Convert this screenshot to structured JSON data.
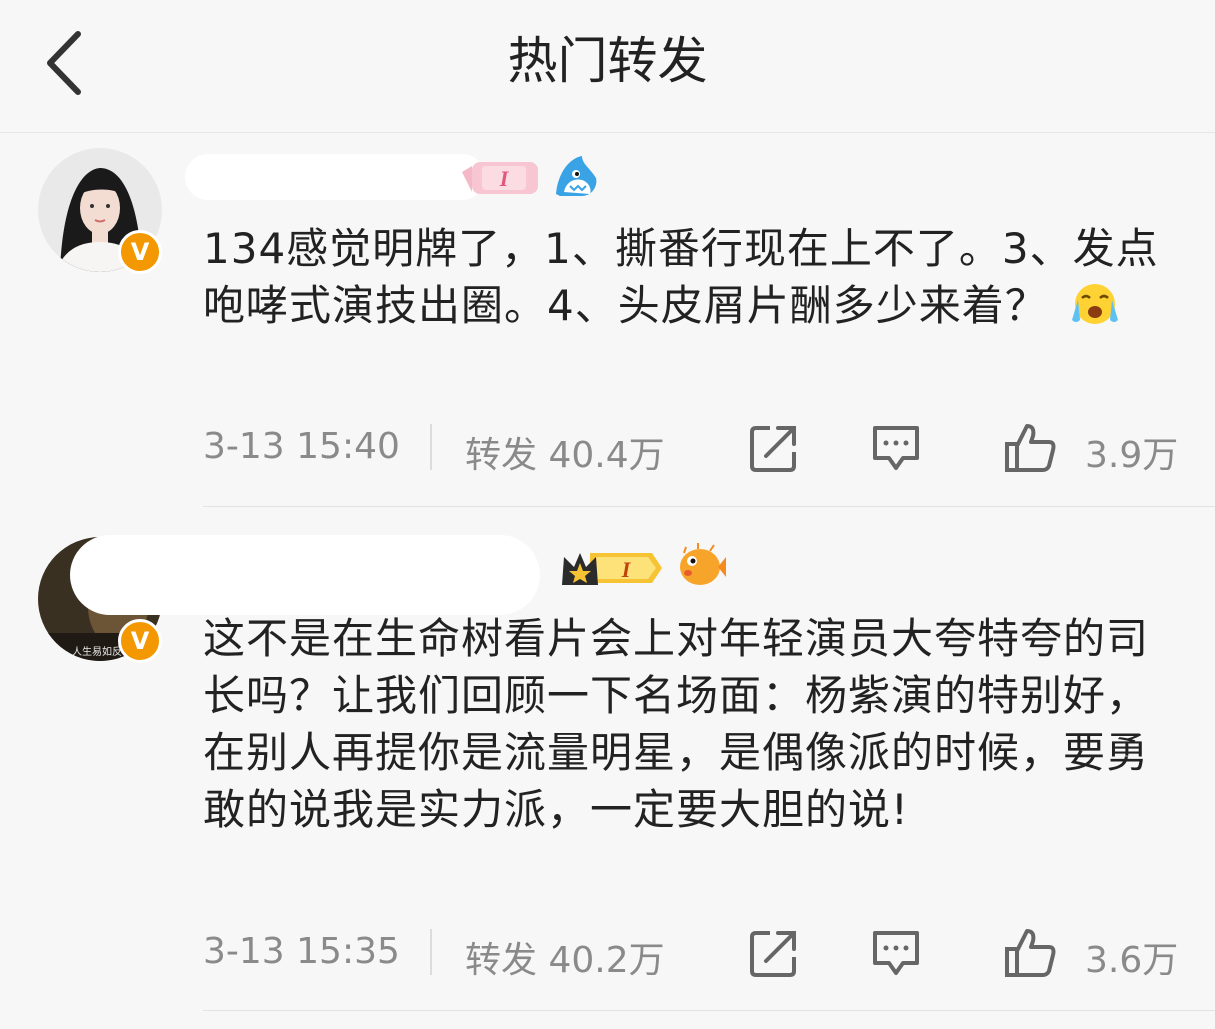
{
  "header": {
    "title": "热门转发"
  },
  "posts": [
    {
      "content": "134感觉明牌了，1、撕番行现在上不了。3、发点咆哮式演技出圈。4、头皮屑片酬多少来着？",
      "time": "3-13 15:40",
      "repost_label": "转发 40.4万",
      "likes": "3.9万",
      "verified_mark": "V"
    },
    {
      "content": "这不是在生命树看片会上对年轻演员大夸特夸的司长吗？让我们回顾一下名场面：杨紫演的特别好，在别人再提你是流量明星，是偶像派的时候，要勇敢的说我是实力派，一定要大胆的说!",
      "time": "3-13 15:35",
      "repost_label": "转发 40.2万",
      "likes": "3.6万",
      "verified_mark": "V",
      "avatar_caption": "人生易如反"
    }
  ],
  "icons": {
    "back": "chevron-left-icon",
    "share": "share-icon",
    "comment": "comment-icon",
    "like": "thumbs-up-icon"
  },
  "colors": {
    "verified": "#f39800",
    "meta_text": "#8a8a8a",
    "background": "#f7f7f7"
  }
}
